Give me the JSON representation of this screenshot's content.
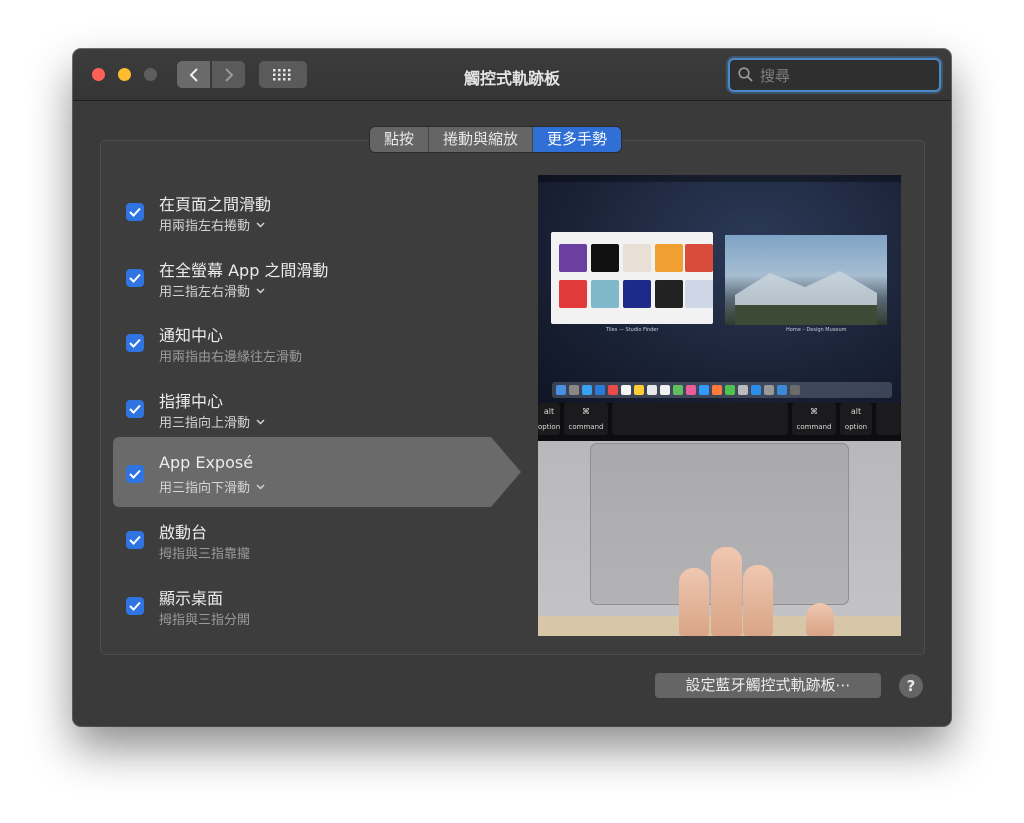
{
  "window": {
    "title": "觸控式軌跡板"
  },
  "search": {
    "placeholder": "搜尋",
    "value": ""
  },
  "tabs": [
    {
      "label": "點按",
      "active": false
    },
    {
      "label": "捲動與縮放",
      "active": false
    },
    {
      "label": "更多手勢",
      "active": true
    }
  ],
  "gestures": [
    {
      "title": "在頁面之間滑動",
      "subtitle": "用兩指左右捲動",
      "has_menu": true,
      "checked": true
    },
    {
      "title": "在全螢幕 App 之間滑動",
      "subtitle": "用三指左右滑動",
      "has_menu": true,
      "checked": true
    },
    {
      "title": "通知中心",
      "subtitle": "用兩指由右邊緣往左滑動",
      "has_menu": false,
      "checked": true
    },
    {
      "title": "指揮中心",
      "subtitle": "用三指向上滑動",
      "has_menu": true,
      "checked": true
    },
    {
      "title": "App Exposé",
      "subtitle": "用三指向下滑動",
      "has_menu": true,
      "checked": true,
      "selected": true
    },
    {
      "title": "啟動台",
      "subtitle": "拇指與三指靠攏",
      "has_menu": false,
      "checked": true
    },
    {
      "title": "顯示桌面",
      "subtitle": "拇指與三指分開",
      "has_menu": false,
      "checked": true
    }
  ],
  "preview": {
    "keys": {
      "option_left": "option",
      "command_left": "command",
      "command_right": "command",
      "option_right": "option",
      "cmd_symbol": "⌘",
      "alt_symbol": "alt"
    },
    "window_labels": {
      "left": "Tiles — Studio Finder",
      "right": "Home – Design Museum"
    }
  },
  "footer": {
    "bluetooth_button": "設定藍牙觸控式軌跡板⋯",
    "help_button": "?"
  },
  "colors": {
    "accent": "#2f6fd6",
    "checkbox": "#2f74e0",
    "window_bg": "#3a3a3a"
  }
}
